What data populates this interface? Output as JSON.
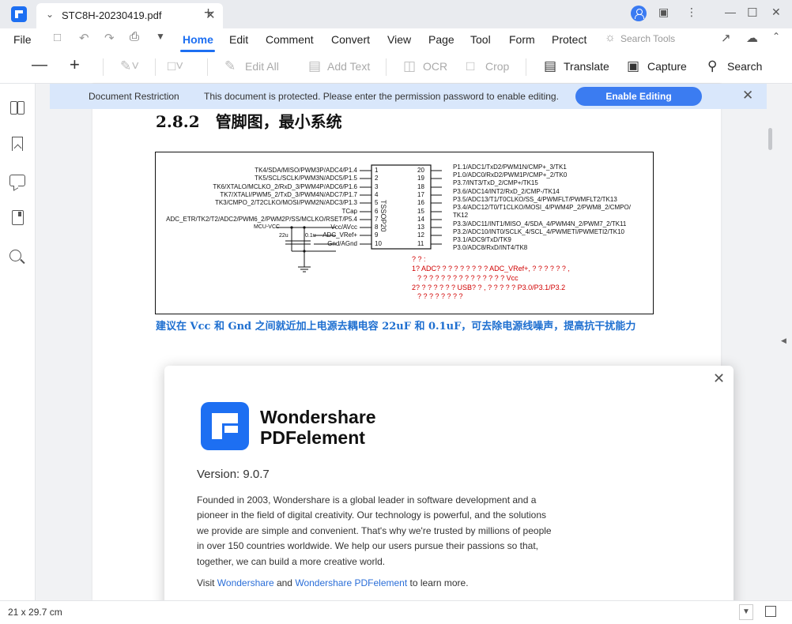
{
  "window": {
    "tab_title": "STC8H-20230419.pdf",
    "tab_close_icon": "close-icon",
    "new_tab_icon": "plus-icon"
  },
  "menubar": {
    "file": "File",
    "tabs": [
      "Home",
      "Edit",
      "Comment",
      "Convert",
      "View",
      "Page",
      "Tool",
      "Form",
      "Protect"
    ],
    "active_tab": "Home",
    "search_tools": "Search Tools"
  },
  "toolbar": {
    "edit_all": "Edit All",
    "add_text": "Add Text",
    "ocr": "OCR",
    "crop": "Crop",
    "translate": "Translate",
    "capture": "Capture",
    "search": "Search"
  },
  "banner": {
    "label": "Document Restriction",
    "message": "This document is protected. Please enter the permission password to enable editing.",
    "button": "Enable Editing"
  },
  "document": {
    "section_number": "2.8.2",
    "section_title": "管脚图，最小系统",
    "chip_label": "TSSOP20",
    "left_pins": [
      {
        "num": "1",
        "label": "TK4/SDA/MISO/PWM3P/ADC4/P1.4"
      },
      {
        "num": "2",
        "label": "TK5/SCL/SCLK/PWM3N/ADC5/P1.5"
      },
      {
        "num": "3",
        "label": "TK6/XTALO/MCLKO_2/RxD_3/PWM4P/ADC6/P1.6"
      },
      {
        "num": "4",
        "label": "TK7/XTALI/PWM5_2/TxD_3/PWM4N/ADC7/P1.7"
      },
      {
        "num": "5",
        "label": "TK3/CMPO_2/T2CLKO/MOSI/PWM2N/ADC3/P1.3"
      },
      {
        "num": "6",
        "label": "TCap"
      },
      {
        "num": "7",
        "label": "ADC_ETR/TK2/T2/ADC2/PWM6_2/PWM2P/SS/MCLKO/RSET/P5.4"
      },
      {
        "num": "8",
        "label": "Vcc/AVcc"
      },
      {
        "num": "9",
        "label": "ADC_VRef+"
      },
      {
        "num": "10",
        "label": "Gnd/AGnd"
      }
    ],
    "right_pins": [
      {
        "num": "20",
        "label": "P1.1/ADC1/TxD2/PWM1N/CMP+_3/TK1"
      },
      {
        "num": "19",
        "label": "P1.0/ADC0/RxD2/PWM1P/CMP+_2/TK0"
      },
      {
        "num": "18",
        "label": "P3.7/INT3/TxD_2/CMP+/TK15"
      },
      {
        "num": "17",
        "label": "P3.6/ADC14/INT2/RxD_2/CMP-/TK14"
      },
      {
        "num": "16",
        "label": "P3.5/ADC13/T1/T0CLKO/SS_4/PWMFLT/PWMFLT2/TK13"
      },
      {
        "num": "15",
        "label": "P3.4/ADC12/T0/T1CLKO/MOSI_4/PWM4P_2/PWM8_2/CMPO/"
      },
      {
        "num": "14",
        "label": "P3.3/ADC11/INT1/MISO_4/SDA_4/PWM4N_2/PWM7_2/TK11"
      },
      {
        "num": "13",
        "label": "P3.2/ADC10/INT0/SCLK_4/SCL_4/PWMETI/PWMETI2/TK10"
      },
      {
        "num": "12",
        "label": "P3.1/ADC9/TxD/TK9"
      },
      {
        "num": "11",
        "label": "P3.0/ADC8/RxD/INT4/TK8"
      }
    ],
    "right_pin_wrap": "TK12",
    "mcu_vcc": "MCU-VCC",
    "cap1": "22u",
    "cap2": "0.1u",
    "notes": [
      "? ? :",
      "1? ADC? ? ? ? ? ? ? ? ? ADC_VRef+, ? ? ? ? ? ? ,",
      "? ? ? ? ? ? ? ? ? ? ? ? ? ? ? Vcc",
      "2? ? ? ? ? ? ? USB? ? , ? ? ? ? ? P3.0/P3.1/P3.2",
      "? ? ? ? ? ? ? ?"
    ],
    "caption": "建议在 Vcc 和 Gnd 之间就近加上电源去耦电容 22uF 和 0.1uF，可去除电源线噪声，提高抗干扰能力"
  },
  "dialog": {
    "brand_line1": "Wondershare",
    "brand_line2": "PDFelement",
    "version": "Version: 9.0.7",
    "about_lines": [
      "Founded in 2003, Wondershare is a global leader in software development and a",
      "pioneer in the field of digital creativity. Our technology is powerful, and the solutions",
      "we provide are simple and convenient. That's why we're trusted by millions of people",
      "in over 150 countries worldwide. We help our users pursue their passions so that,",
      "together, we can build a more creative world."
    ],
    "visit_prefix": "Visit ",
    "visit_link1": "Wondershare",
    "visit_mid": " and ",
    "visit_link2": "Wondershare PDFelement",
    "visit_suffix": " to learn more.",
    "dots": "• • •"
  },
  "statusbar": {
    "page_size": "21 x 29.7 cm"
  }
}
